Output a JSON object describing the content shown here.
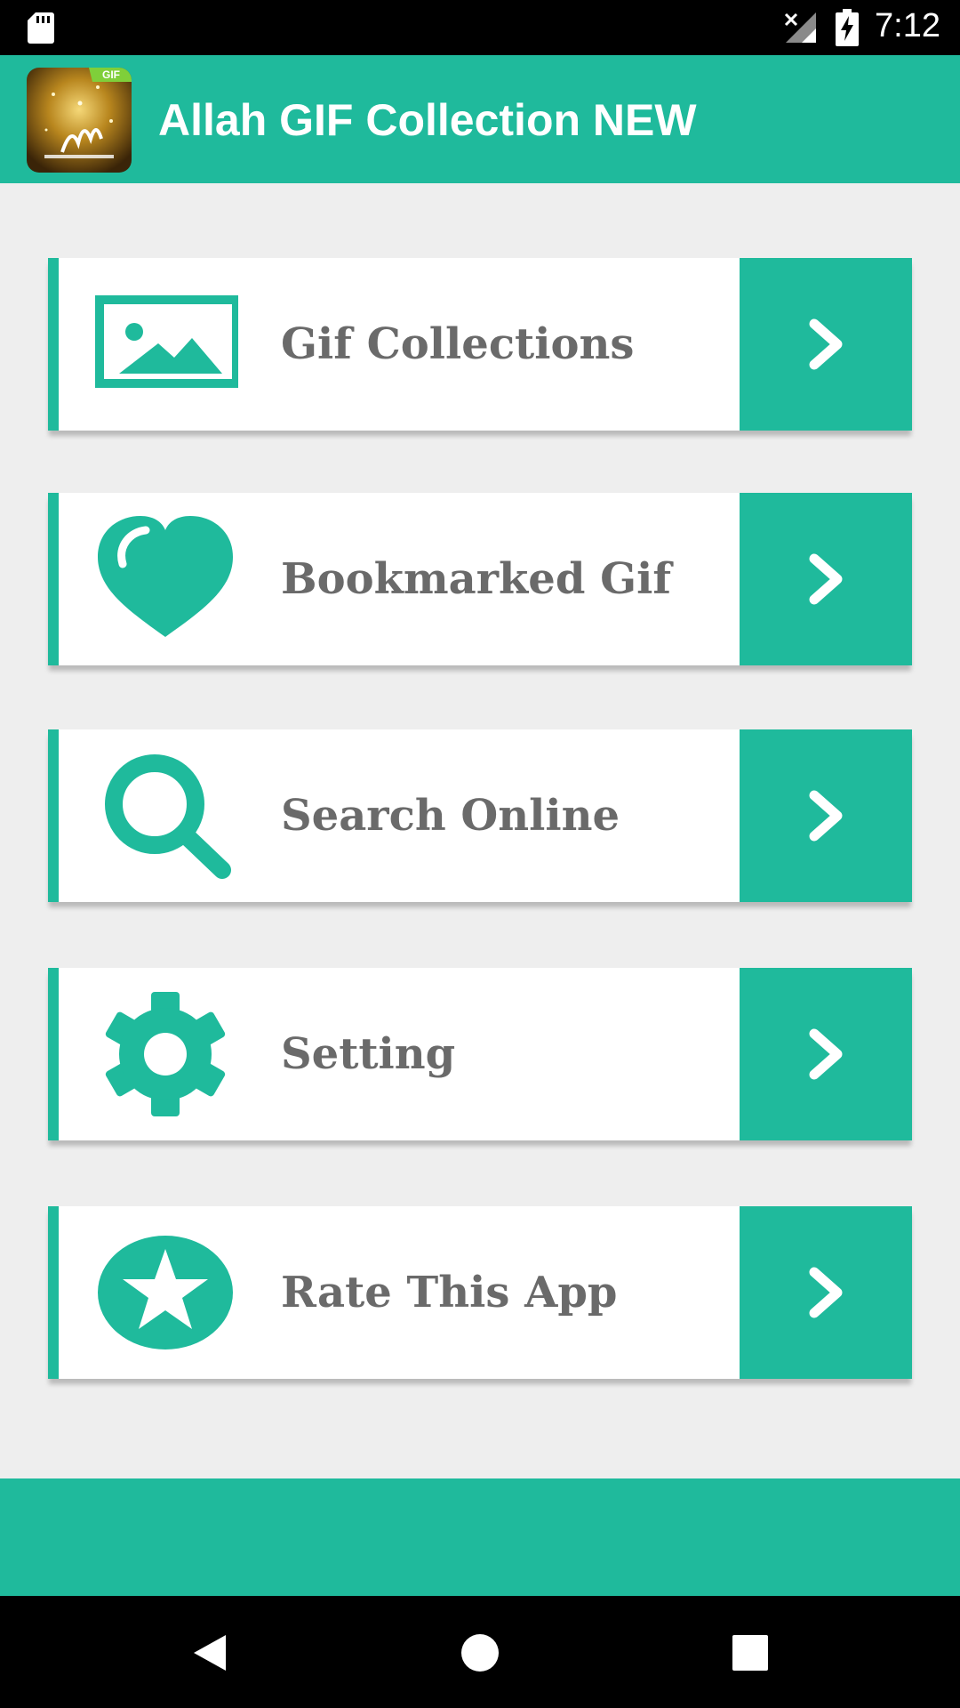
{
  "status_bar": {
    "time": "7:12",
    "icons": [
      "sd-card-icon",
      "signal-no-data-icon",
      "battery-charging-icon"
    ]
  },
  "app_bar": {
    "title": "Allah GIF Collection NEW",
    "icon_badge": "GIF"
  },
  "accent_color": "#1fba9c",
  "menu": {
    "items": [
      {
        "label": "Gif Collections",
        "icon": "image-icon"
      },
      {
        "label": "Bookmarked Gif",
        "icon": "heart-icon"
      },
      {
        "label": "Search Online",
        "icon": "search-icon"
      },
      {
        "label": "Setting",
        "icon": "gear-icon"
      },
      {
        "label": "Rate This App",
        "icon": "star-circle-icon"
      }
    ]
  },
  "nav_bar": {
    "buttons": [
      "back-icon",
      "home-icon",
      "recents-icon"
    ]
  }
}
